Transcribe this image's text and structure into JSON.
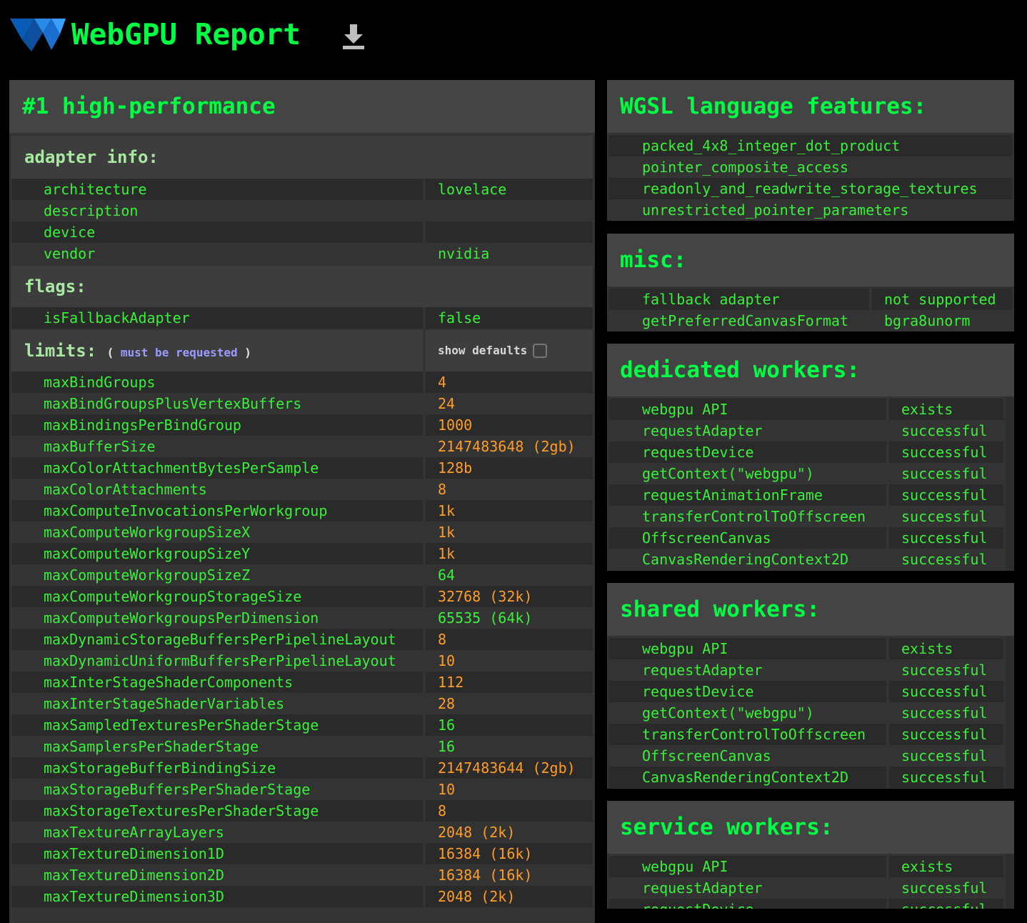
{
  "header": {
    "title": "WebGPU Report",
    "download_icon": "download-icon",
    "logo_colors": [
      "#0a5bb5",
      "#2a8ae8"
    ]
  },
  "adapter": {
    "title": "#1 high-performance",
    "adapter_info_label": "adapter info:",
    "adapter_info": [
      {
        "k": "architecture",
        "v": "lovelace"
      },
      {
        "k": "description",
        "v": ""
      },
      {
        "k": "device",
        "v": ""
      },
      {
        "k": "vendor",
        "v": "nvidia"
      }
    ],
    "flags_label": "flags:",
    "flags": [
      {
        "k": "isFallbackAdapter",
        "v": "false"
      }
    ],
    "limits_label": "limits:",
    "limits_note_open": "(",
    "limits_note_text": "must be requested",
    "limits_note_close": ")",
    "show_defaults_label": "show defaults",
    "limits": [
      {
        "k": "maxBindGroups",
        "v": "4",
        "c": "orange"
      },
      {
        "k": "maxBindGroupsPlusVertexBuffers",
        "v": "24",
        "c": "orange"
      },
      {
        "k": "maxBindingsPerBindGroup",
        "v": "1000",
        "c": "orange"
      },
      {
        "k": "maxBufferSize",
        "v": "2147483648 (2gb)",
        "c": "orange"
      },
      {
        "k": "maxColorAttachmentBytesPerSample",
        "v": "128b",
        "c": "orange"
      },
      {
        "k": "maxColorAttachments",
        "v": "8",
        "c": "orange"
      },
      {
        "k": "maxComputeInvocationsPerWorkgroup",
        "v": "1k",
        "c": "orange"
      },
      {
        "k": "maxComputeWorkgroupSizeX",
        "v": "1k",
        "c": "orange"
      },
      {
        "k": "maxComputeWorkgroupSizeY",
        "v": "1k",
        "c": "orange"
      },
      {
        "k": "maxComputeWorkgroupSizeZ",
        "v": "64",
        "c": "green"
      },
      {
        "k": "maxComputeWorkgroupStorageSize",
        "v": "32768 (32k)",
        "c": "orange"
      },
      {
        "k": "maxComputeWorkgroupsPerDimension",
        "v": "65535 (64k)",
        "c": "green"
      },
      {
        "k": "maxDynamicStorageBuffersPerPipelineLayout",
        "v": "8",
        "c": "orange"
      },
      {
        "k": "maxDynamicUniformBuffersPerPipelineLayout",
        "v": "10",
        "c": "orange"
      },
      {
        "k": "maxInterStageShaderComponents",
        "v": "112",
        "c": "orange"
      },
      {
        "k": "maxInterStageShaderVariables",
        "v": "28",
        "c": "orange"
      },
      {
        "k": "maxSampledTexturesPerShaderStage",
        "v": "16",
        "c": "green"
      },
      {
        "k": "maxSamplersPerShaderStage",
        "v": "16",
        "c": "green"
      },
      {
        "k": "maxStorageBufferBindingSize",
        "v": "2147483644 (2gb)",
        "c": "orange"
      },
      {
        "k": "maxStorageBuffersPerShaderStage",
        "v": "10",
        "c": "orange"
      },
      {
        "k": "maxStorageTexturesPerShaderStage",
        "v": "8",
        "c": "orange"
      },
      {
        "k": "maxTextureArrayLayers",
        "v": "2048 (2k)",
        "c": "orange"
      },
      {
        "k": "maxTextureDimension1D",
        "v": "16384 (16k)",
        "c": "orange"
      },
      {
        "k": "maxTextureDimension2D",
        "v": "16384 (16k)",
        "c": "orange"
      },
      {
        "k": "maxTextureDimension3D",
        "v": "2048 (2k)",
        "c": "orange"
      }
    ]
  },
  "wgsl": {
    "title": "WGSL language features:",
    "items": [
      "packed_4x8_integer_dot_product",
      "pointer_composite_access",
      "readonly_and_readwrite_storage_textures",
      "unrestricted_pointer_parameters"
    ]
  },
  "misc": {
    "title": "misc:",
    "rows": [
      {
        "k": "fallback adapter",
        "v": "not supported"
      },
      {
        "k": "getPreferredCanvasFormat",
        "v": "bgra8unorm"
      }
    ]
  },
  "dedicated_workers": {
    "title": "dedicated workers:",
    "rows": [
      {
        "k": "webgpu API",
        "v": "exists"
      },
      {
        "k": "requestAdapter",
        "v": "successful"
      },
      {
        "k": "requestDevice",
        "v": "successful"
      },
      {
        "k": "getContext(\"webgpu\")",
        "v": "successful"
      },
      {
        "k": "requestAnimationFrame",
        "v": "successful"
      },
      {
        "k": "transferControlToOffscreen",
        "v": "successful"
      },
      {
        "k": "OffscreenCanvas",
        "v": "successful"
      },
      {
        "k": "CanvasRenderingContext2D",
        "v": "successful"
      }
    ]
  },
  "shared_workers": {
    "title": "shared workers:",
    "rows": [
      {
        "k": "webgpu API",
        "v": "exists"
      },
      {
        "k": "requestAdapter",
        "v": "successful"
      },
      {
        "k": "requestDevice",
        "v": "successful"
      },
      {
        "k": "getContext(\"webgpu\")",
        "v": "successful"
      },
      {
        "k": "transferControlToOffscreen",
        "v": "successful"
      },
      {
        "k": "OffscreenCanvas",
        "v": "successful"
      },
      {
        "k": "CanvasRenderingContext2D",
        "v": "successful"
      }
    ]
  },
  "service_workers": {
    "title": "service workers:",
    "rows": [
      {
        "k": "webgpu API",
        "v": "exists"
      },
      {
        "k": "requestAdapter",
        "v": "successful"
      },
      {
        "k": "requestDevice",
        "v": "successful"
      }
    ]
  }
}
